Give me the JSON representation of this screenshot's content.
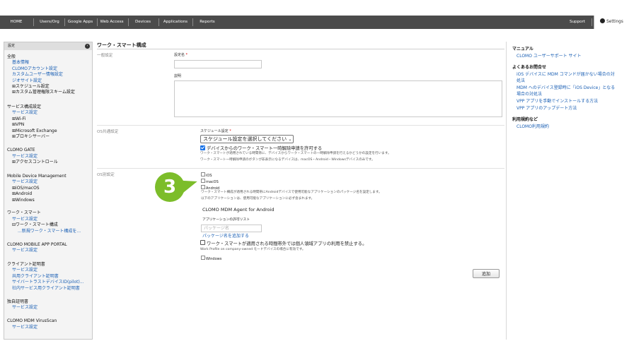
{
  "nav": {
    "items": [
      "HOME",
      "Users/Org",
      "Google Apps",
      "Web Access",
      "Devices",
      "Applications",
      "Reports"
    ],
    "support": "Support",
    "settings": "Settings"
  },
  "sidebar": {
    "header": "設定",
    "groups": [
      {
        "title": "全般",
        "items": [
          "基本情報",
          "CLOMOアカウント設定",
          "カスタムユーザー情報設定",
          "ジオサイト設定",
          "⊞スケジュール設定",
          "⊞カスタム管理権限スキーム設定"
        ]
      },
      {
        "title": "サービス構成設定",
        "items": [
          "サービス設定",
          "⊞Wi-Fi",
          "⊞VPN",
          "⊞Microsoft Exchange",
          "⊞プロキシサーバー"
        ]
      },
      {
        "title": "CLOMO GATE",
        "items": [
          "サービス設定",
          "⊞アクセスコントロール"
        ]
      },
      {
        "title": "Mobile Device Management",
        "items": [
          "サービス設定",
          "⊞iOS/macOS",
          "⊞Android",
          "⊞Windows"
        ]
      },
      {
        "title": "ワーク・スマート",
        "items": [
          "サービス設定",
          "⊟ワーク・スマート構成",
          "...新規ワーク・スマート構成を..."
        ]
      },
      {
        "title": "CLOMO MOBILE APP PORTAL",
        "items": [
          "サービス設定"
        ]
      },
      {
        "title": "クライアント証明書",
        "items": [
          "サービス設定",
          "共用クライアント証明書",
          "サイバートラストデバイスID(pilot)...",
          "社内サービス用クライアント証明書"
        ]
      },
      {
        "title": "独自証明書",
        "items": [
          "サービス設定"
        ]
      },
      {
        "title": "CLOMO MDM VirusScan",
        "items": [
          "サービス設定"
        ]
      }
    ]
  },
  "main": {
    "title": "ワーク・スマート構成",
    "general": {
      "section": "一般設定",
      "name_label": "設定名",
      "required_mark": "*",
      "desc_label": "説明"
    },
    "os_common": {
      "section": "OS共通設定",
      "schedule_label": "スケジュール設定",
      "schedule_value": "スケジュール設定を選択してください",
      "allow_checkbox": "デバイスからのワーク・スマート一時解除申請を許可する",
      "allow_desc1": "ワーク・スマートが適用されている時間帯に、デバイスからワーク・スマートの一時解除申請を行えるかどうかの設定を行います。",
      "allow_desc2": "ワーク・スマート一時解除申請のボタンが非表示になるデバイスは、macOS・Android・Windowsデバイスのみです。"
    },
    "os_specific": {
      "section": "OS別設定",
      "ios": "iOS",
      "macos": "macOS",
      "android": "Android",
      "android_desc1": "ワーク・スマート構成が適用される時間帯にAndroidデバイスで使用可能なアプリケーションのパッケージ名を設定します。",
      "android_desc2": "以下のアプリケーションは、使用可能なアプリケーションに必ず含まれます。",
      "agent": "CLOMO MDM Agent for Android",
      "allow_list_label": "アプリケーションの許可リスト",
      "package_placeholder": "パッケージ名",
      "add_package_link": "パッケージ名を追加する",
      "prohibit_checkbox": "ワーク・スマートが適用される時間帯外では個人領域アプリの利用を禁止する。",
      "prohibit_desc": "Work Profile on company-owned モードデバイスの場合に有効です。",
      "windows": "Windows"
    },
    "add_button": "追加"
  },
  "right_panel": {
    "manual_title": "マニュアル",
    "manual_link": "CLOMO ユーザーサポート サイト",
    "faq_title": "よくあるお問合せ",
    "faq_links": [
      "iOS デバイスに MDM コマンドが届かない場合の対",
      "処法",
      "MDM へのデバイス登録時に「iOS Device」となる",
      "場合の対処法",
      "VPP アプリを手動でインストールする方法",
      "VPP アプリのアップデート方法"
    ],
    "terms_title": "利用規約など",
    "terms_link": "CLOMO利用規約"
  },
  "callout": {
    "number": "3",
    "color": "#7cbd2a"
  }
}
